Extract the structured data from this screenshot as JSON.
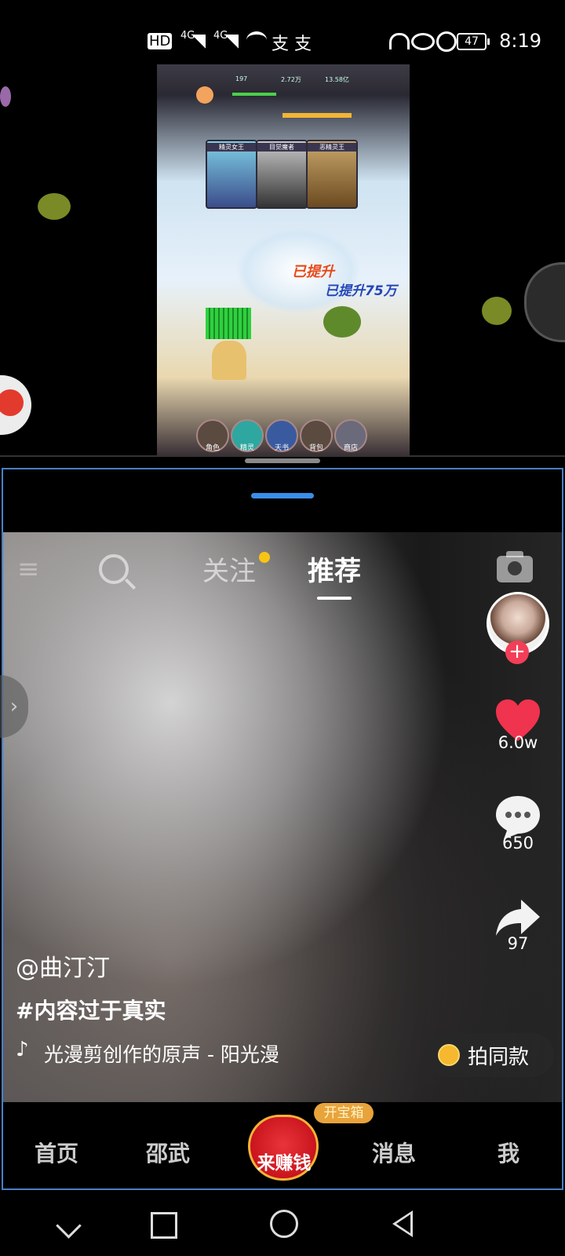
{
  "status_bar": {
    "network_hd": "HD",
    "signal1": "4G",
    "signal2": "4G",
    "app_notifs": "支 支",
    "battery": "47",
    "time": "8:19"
  },
  "game": {
    "stats": [
      "197",
      "2.72万",
      "13.58亿"
    ],
    "cards": [
      "精灵女王",
      "目觉魔者",
      "恶精灵王"
    ],
    "damage_text_1": "已提升",
    "damage_text_2": "已提升75万",
    "nav": [
      "角色",
      "精灵",
      "天书",
      "背包",
      "商店"
    ]
  },
  "video": {
    "top_tabs": {
      "follow": "关注",
      "recommend": "推荐"
    },
    "likes": "6.0w",
    "comments": "650",
    "shares": "97",
    "author": "@曲汀汀",
    "hashtag": "#内容过于真实",
    "music": "光漫剪创作的原声 - 阳光漫",
    "same_style_label": "拍同款"
  },
  "bottom_tabs": {
    "home": "首页",
    "nearby": "邵武",
    "earn": "来赚钱",
    "chest_badge": "开宝箱",
    "messages": "消息",
    "me": "我"
  },
  "colors": {
    "accent_red": "#f33e58",
    "split_blue": "#3a8ee8",
    "dot_yellow": "#f7c416"
  }
}
